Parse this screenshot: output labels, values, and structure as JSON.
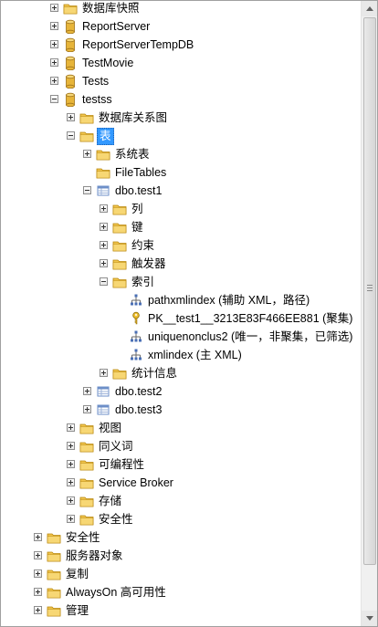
{
  "tree": {
    "nodes": [
      {
        "label": "数据库快照",
        "level": 2,
        "expander": "plus",
        "icon": "folder-icon"
      },
      {
        "label": "ReportServer",
        "level": 2,
        "expander": "plus",
        "icon": "database-icon"
      },
      {
        "label": "ReportServerTempDB",
        "level": 2,
        "expander": "plus",
        "icon": "database-icon"
      },
      {
        "label": "TestMovie",
        "level": 2,
        "expander": "plus",
        "icon": "database-icon"
      },
      {
        "label": "Tests",
        "level": 2,
        "expander": "plus",
        "icon": "database-icon"
      },
      {
        "label": "testss",
        "level": 2,
        "expander": "minus",
        "icon": "database-icon"
      },
      {
        "label": "数据库关系图",
        "level": 3,
        "expander": "plus",
        "icon": "folder-icon"
      },
      {
        "label": "表",
        "level": 3,
        "expander": "minus",
        "icon": "folder-icon",
        "selected": true
      },
      {
        "label": "系统表",
        "level": 4,
        "expander": "plus",
        "icon": "folder-icon"
      },
      {
        "label": "FileTables",
        "level": 4,
        "expander": "none",
        "icon": "folder-icon"
      },
      {
        "label": "dbo.test1",
        "level": 4,
        "expander": "minus",
        "icon": "table-icon"
      },
      {
        "label": "列",
        "level": 5,
        "expander": "plus",
        "icon": "folder-icon"
      },
      {
        "label": "键",
        "level": 5,
        "expander": "plus",
        "icon": "folder-icon"
      },
      {
        "label": "约束",
        "level": 5,
        "expander": "plus",
        "icon": "folder-icon"
      },
      {
        "label": "触发器",
        "level": 5,
        "expander": "plus",
        "icon": "folder-icon"
      },
      {
        "label": "索引",
        "level": 5,
        "expander": "minus",
        "icon": "folder-icon"
      },
      {
        "label": "pathxmlindex (辅助 XML，路径)",
        "level": 6,
        "expander": "none",
        "icon": "index-icon"
      },
      {
        "label": "PK__test1__3213E83F466EE881 (聚集)",
        "level": 6,
        "expander": "none",
        "icon": "key-icon"
      },
      {
        "label": "uniquenonclus2 (唯一，非聚集，已筛选)",
        "level": 6,
        "expander": "none",
        "icon": "index-icon"
      },
      {
        "label": "xmlindex (主 XML)",
        "level": 6,
        "expander": "none",
        "icon": "index-icon"
      },
      {
        "label": "统计信息",
        "level": 5,
        "expander": "plus",
        "icon": "folder-icon"
      },
      {
        "label": "dbo.test2",
        "level": 4,
        "expander": "plus",
        "icon": "table-icon"
      },
      {
        "label": "dbo.test3",
        "level": 4,
        "expander": "plus",
        "icon": "table-icon"
      },
      {
        "label": "视图",
        "level": 3,
        "expander": "plus",
        "icon": "folder-icon"
      },
      {
        "label": "同义词",
        "level": 3,
        "expander": "plus",
        "icon": "folder-icon"
      },
      {
        "label": "可编程性",
        "level": 3,
        "expander": "plus",
        "icon": "folder-icon"
      },
      {
        "label": "Service Broker",
        "level": 3,
        "expander": "plus",
        "icon": "folder-icon"
      },
      {
        "label": "存储",
        "level": 3,
        "expander": "plus",
        "icon": "folder-icon"
      },
      {
        "label": "安全性",
        "level": 3,
        "expander": "plus",
        "icon": "folder-icon"
      },
      {
        "label": "安全性",
        "level": 1,
        "expander": "plus",
        "icon": "folder-icon"
      },
      {
        "label": "服务器对象",
        "level": 1,
        "expander": "plus",
        "icon": "folder-icon"
      },
      {
        "label": "复制",
        "level": 1,
        "expander": "plus",
        "icon": "folder-icon"
      },
      {
        "label": "AlwaysOn 高可用性",
        "level": 1,
        "expander": "plus",
        "icon": "folder-icon"
      },
      {
        "label": "管理",
        "level": 1,
        "expander": "plus",
        "icon": "folder-icon"
      }
    ]
  },
  "colors": {
    "folder": "#f0c44c",
    "database": "#e7b53a",
    "selection": "#3399ff",
    "table": "#6d8fc8"
  }
}
